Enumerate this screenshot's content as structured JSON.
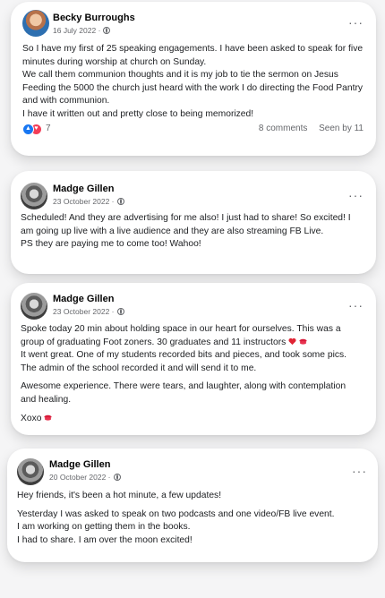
{
  "posts": [
    {
      "author": "Becky Burroughs",
      "date": "16 July 2022 ·",
      "more": "···",
      "lines": [
        "So I have my first of 25 speaking engagements. I have been asked to speak for five minutes during worship at church on Sunday.",
        "We call them communion thoughts and it is my job to tie the sermon on Jesus Feeding the 5000 the church just heard with the work I do directing the Food Pantry and with communion.",
        "I have it written out and pretty close to being memorized!"
      ],
      "reaction_count": "7",
      "comments": "8 comments",
      "seen_by": "Seen by 11"
    },
    {
      "author": "Madge Gillen",
      "date": "23 October 2022 ·",
      "more": "···",
      "lines": [
        "Scheduled! And they are advertising for me also! I just had to share! So excited! I am going up live with a live audience and they are also streaming FB Live.",
        "PS they are paying me to come too! Wahoo!"
      ]
    },
    {
      "author": "Madge Gillen",
      "date": "23 October 2022 ·",
      "more": "···",
      "line1": "Spoke today 20 min about holding space in our heart for ourselves. This was a group of graduating Foot zoners. 30 graduates and 11 instructors",
      "line2": "It went great. One of my students recorded bits and pieces, and took some pics. The admin of the school recorded it and will send it to me.",
      "line3": "Awesome experience. There were tears, and laughter, along with contemplation and healing.",
      "line4": "Xoxo"
    },
    {
      "author": "Madge Gillen",
      "date": "20 October 2022 ·",
      "more": "···",
      "line1": "Hey friends, it's been a hot minute, a few updates!",
      "lines": [
        "Yesterday I was asked to speak on two podcasts and one video/FB live event.",
        "I am working on getting them in the books.",
        "I had to share. I am over the moon excited!"
      ]
    }
  ]
}
